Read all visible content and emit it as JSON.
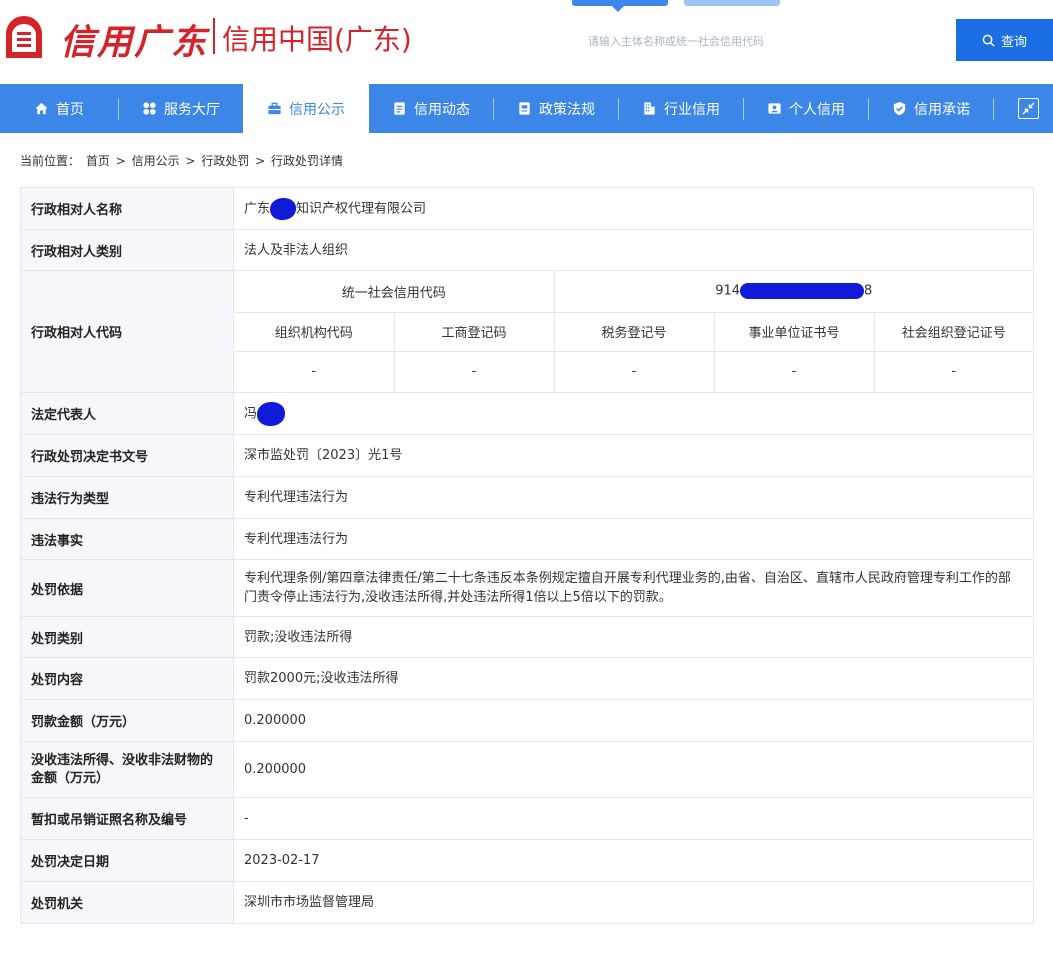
{
  "header": {
    "logo_script": "信用广东",
    "logo_sub": "信用中国(广东)",
    "search_placeholder": "请输入主体名称或统一社会信用代码",
    "search_button": "查询"
  },
  "nav": {
    "items": [
      {
        "label": "首页",
        "icon": "home-icon"
      },
      {
        "label": "服务大厅",
        "icon": "grid-icon"
      },
      {
        "label": "信用公示",
        "icon": "briefcase-icon",
        "active": true
      },
      {
        "label": "信用动态",
        "icon": "document-icon"
      },
      {
        "label": "政策法规",
        "icon": "book-icon"
      },
      {
        "label": "行业信用",
        "icon": "building-icon"
      },
      {
        "label": "个人信用",
        "icon": "id-card-icon"
      },
      {
        "label": "信用承诺",
        "icon": "shield-check-icon"
      }
    ],
    "exit_icon": "fullscreen-exit-icon"
  },
  "breadcrumb": {
    "prefix": "当前位置：",
    "items": [
      "首页",
      "信用公示",
      "行政处罚",
      "行政处罚详情"
    ],
    "separator": ">"
  },
  "detail": {
    "rows": [
      {
        "key": "行政相对人名称",
        "value_prefix": "广东",
        "value_suffix": "知识产权代理有限公司"
      },
      {
        "key": "行政相对人类别",
        "value": "法人及非法人组织"
      },
      {
        "key": "行政相对人代码"
      },
      {
        "key": "法定代表人",
        "value_prefix": "冯"
      },
      {
        "key": "行政处罚决定书文号",
        "value": "深市监处罚〔2023〕光1号"
      },
      {
        "key": "违法行为类型",
        "value": "专利代理违法行为"
      },
      {
        "key": "违法事实",
        "value": "专利代理违法行为"
      },
      {
        "key": "处罚依据",
        "value": "专利代理条例/第四章法律责任/第二十七条违反本条例规定擅自开展专利代理业务的,由省、自治区、直辖市人民政府管理专利工作的部门责令停止违法行为,没收违法所得,并处违法所得1倍以上5倍以下的罚款。"
      },
      {
        "key": "处罚类别",
        "value": "罚款;没收违法所得"
      },
      {
        "key": "处罚内容",
        "value": "罚款2000元;没收违法所得"
      },
      {
        "key": "罚款金额（万元）",
        "value": "0.200000"
      },
      {
        "key": "没收违法所得、没收非法财物的金额（万元）",
        "value": "0.200000"
      },
      {
        "key": "暂扣或吊销证照名称及编号",
        "value": "-"
      },
      {
        "key": "处罚决定日期",
        "value": "2023-02-17"
      },
      {
        "key": "处罚机关",
        "value": "深圳市市场监督管理局"
      }
    ],
    "code_block": {
      "uscc_label": "统一社会信用代码",
      "uscc_prefix": "914",
      "uscc_suffix": "8",
      "columns": [
        "组织机构代码",
        "工商登记码",
        "税务登记号",
        "事业单位证书号",
        "社会组织登记证号"
      ],
      "values": [
        "-",
        "-",
        "-",
        "-",
        "-"
      ]
    }
  }
}
